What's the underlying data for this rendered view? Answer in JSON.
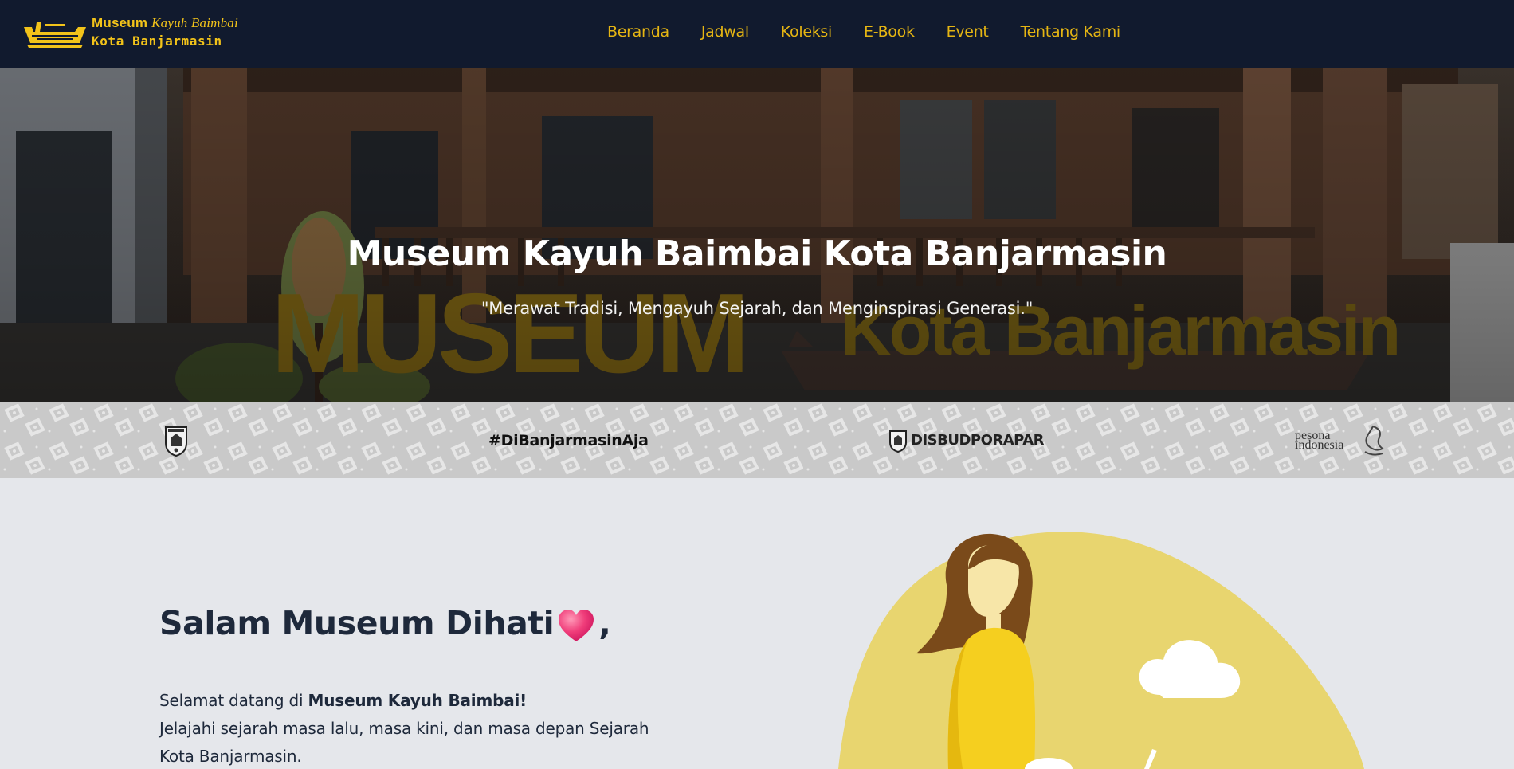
{
  "brand": {
    "line1": "Museum",
    "line1_script": "Kayuh Baimbai",
    "line2": "Kota Banjarmasin",
    "boat_icon": "boat-logo-icon"
  },
  "nav": {
    "items": [
      {
        "label": "Beranda"
      },
      {
        "label": "Jadwal"
      },
      {
        "label": "Koleksi"
      },
      {
        "label": "E-Book"
      },
      {
        "label": "Event"
      },
      {
        "label": "Tentang Kami"
      }
    ]
  },
  "hero": {
    "title": "Museum Kayuh Baimbai Kota Banjarmasin",
    "subtitle": "\"Merawat Tradisi, Mengayuh Sejarah, dan Menginspirasi Generasi.\"",
    "background_words": [
      "MUSEUM",
      "Kota Banjarmasin"
    ]
  },
  "partners": {
    "items": [
      {
        "label": "",
        "icon": "banjarmasin-crest-icon"
      },
      {
        "label": "#DiBanjarmasinAja"
      },
      {
        "label": "DISBUDPORAPAR",
        "icon": "disbudporapar-crest-icon"
      },
      {
        "label": "pesona indonesia",
        "icon": "pesona-indonesia-icon"
      }
    ]
  },
  "welcome": {
    "greeting": "Salam Museum Dihati",
    "greeting_suffix": ",",
    "intro_prefix": "Selamat datang di ",
    "intro_bold": "Museum Kayuh Baimbai!",
    "intro_rest": "Jelajahi sejarah masa lalu, masa kini, dan masa depan Sejarah Kota Banjarmasin."
  },
  "colors": {
    "navbar_bg": "#111a2e",
    "accent": "#e5b513",
    "content_bg": "#e5e7eb",
    "text_dark": "#1e293b",
    "illustration_yellow": "#e8d56f"
  }
}
